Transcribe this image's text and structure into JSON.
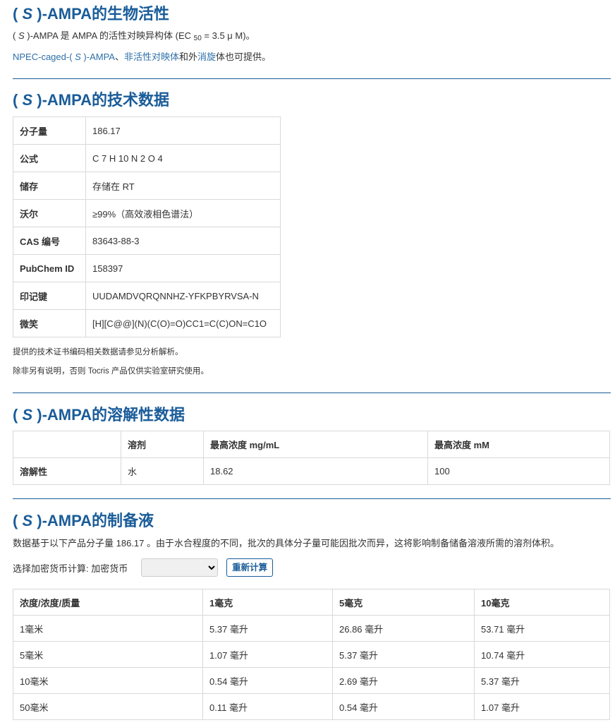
{
  "bio": {
    "title_pre": "( ",
    "title_s": "S",
    "title_post": " )-AMPA的生物活性",
    "desc_pre": "( ",
    "desc_s": "S",
    "desc_mid": " )-AMPA 是 AMPA 的活性对映异构体 (EC ",
    "desc_sub": "50",
    "desc_end": " = 3.5 μ M)。",
    "link1": "NPEC-caged-( ",
    "link1_s": "S",
    "link1_end": " )-AMPA",
    "sep": "、",
    "link2": "非活性对映体",
    "text_and": "和外",
    "link3": "消旋",
    "text_end": "体也可提供。"
  },
  "tech": {
    "title_pre": "( ",
    "title_s": "S",
    "title_post": " )-AMPA的技术数据",
    "rows": [
      {
        "k": "分子量",
        "v": "186.17"
      },
      {
        "k": "公式",
        "v": "C 7 H 10 N 2 O 4"
      },
      {
        "k": "储存",
        "v": "存储在 RT"
      },
      {
        "k": "沃尔",
        "v": "≥99%（高效液相色谱法）"
      },
      {
        "k": "CAS 编号",
        "v": "83643-88-3"
      },
      {
        "k": "PubChem ID",
        "v": "158397"
      },
      {
        "k": "印记键",
        "v": "UUDAMDVQRQNNHZ-YFKPBYRVSA-N"
      },
      {
        "k": "微笑",
        "v": "[H][C@@](N)(C(O)=O)CC1=C(C)ON=C1O"
      }
    ],
    "note1": "提供的技术证书编码相关数据请参见分析解析。",
    "note2": "除非另有说明，否则 Tocris 产品仅供实验室研究使用。"
  },
  "solubility": {
    "title_pre": "( ",
    "title_s": "S",
    "title_post": " )-AMPA的溶解性数据",
    "headers": [
      "",
      "溶剂",
      "最高浓度 mg/mL",
      "最高浓度 mM"
    ],
    "row": [
      "溶解性",
      "水",
      "18.62",
      "100"
    ]
  },
  "prep": {
    "title_pre": "( ",
    "title_s": "S",
    "title_post": " )-AMPA的制备液",
    "desc": "数据基于以下产品分子量 186.17 。由于水合程度的不同，批次的具体分子量可能因批次而异，这将影响制备储备溶液所需的溶剂体积。",
    "select_label": "选择加密货币计算: 加密货币",
    "select_value": "",
    "recalc": "重新计算",
    "headers": [
      "浓度/浓度/质量",
      "1毫克",
      "5毫克",
      "10毫克"
    ],
    "rows": [
      [
        "1毫米",
        "5.37 毫升",
        "26.86 毫升",
        "53.71 毫升"
      ],
      [
        "5毫米",
        "1.07 毫升",
        "5.37 毫升",
        "10.74 毫升"
      ],
      [
        "10毫米",
        "0.54 毫升",
        "2.69 毫升",
        "5.37 毫升"
      ],
      [
        "50毫米",
        "0.11 毫升",
        "0.54 毫升",
        "1.07 毫升"
      ]
    ]
  }
}
